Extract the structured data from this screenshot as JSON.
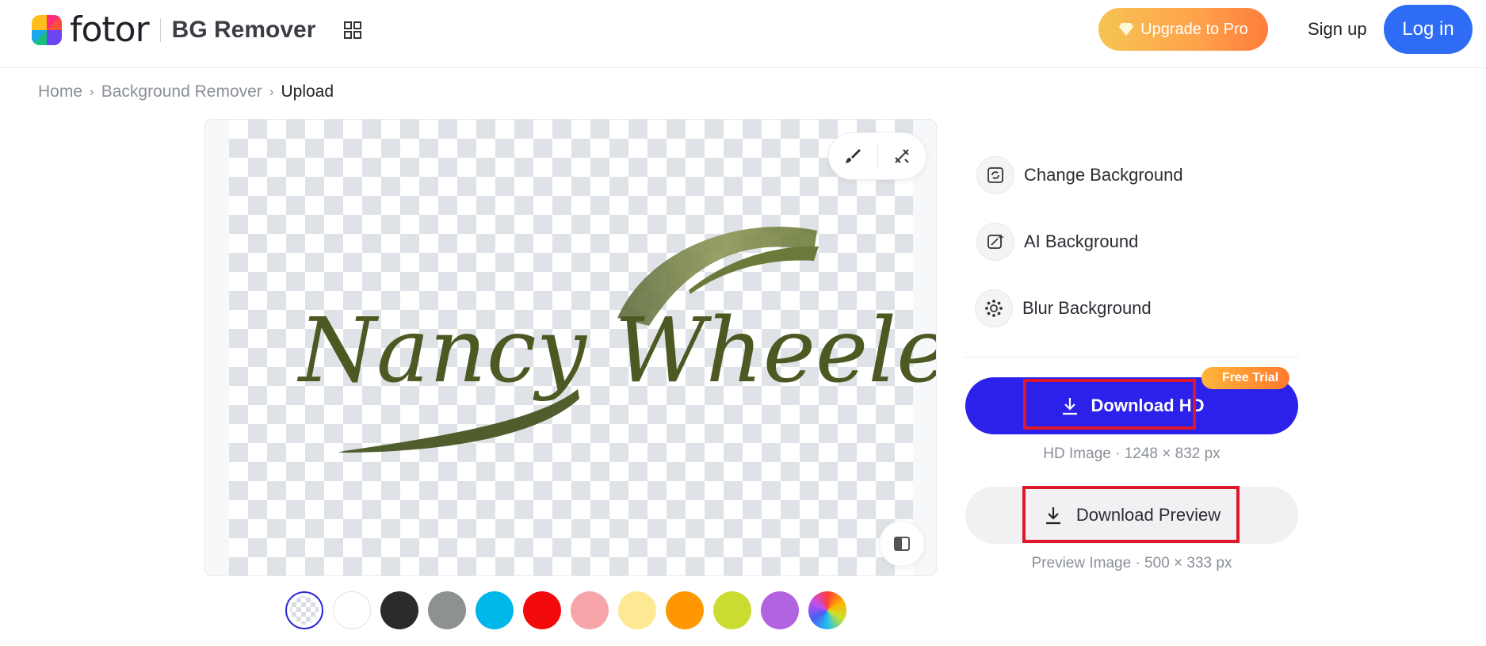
{
  "header": {
    "brand": "fotor",
    "product": "BG Remover",
    "upgrade_label": "Upgrade to Pro",
    "signup_label": "Sign up",
    "login_label": "Log in"
  },
  "breadcrumb": {
    "items": [
      "Home",
      "Background Remover"
    ],
    "current": "Upload"
  },
  "canvas": {
    "signature_text": "Nancy Wheeler"
  },
  "swatches": [
    {
      "name": "transparent",
      "color": "transparent"
    },
    {
      "name": "white",
      "color": "#ffffff"
    },
    {
      "name": "black",
      "color": "#2b2b2b"
    },
    {
      "name": "gray",
      "color": "#8e9191"
    },
    {
      "name": "cyan",
      "color": "#00b7ea"
    },
    {
      "name": "red",
      "color": "#f20a0a"
    },
    {
      "name": "pink",
      "color": "#f7a4a9"
    },
    {
      "name": "yellow",
      "color": "#fde893"
    },
    {
      "name": "orange",
      "color": "#ff9800"
    },
    {
      "name": "lime",
      "color": "#cadb31"
    },
    {
      "name": "purple",
      "color": "#b062e0"
    },
    {
      "name": "custom",
      "color": "rainbow"
    }
  ],
  "panel": {
    "options": [
      {
        "label": "Change Background",
        "icon": "change-background-icon"
      },
      {
        "label": "AI Background",
        "icon": "ai-background-icon"
      },
      {
        "label": "Blur Background",
        "icon": "blur-background-icon"
      }
    ],
    "download_hd_label": "Download HD",
    "free_trial_badge": "Free Trial",
    "hd_info": "HD Image · 1248 × 832 px",
    "download_preview_label": "Download Preview",
    "preview_info": "Preview Image · 500 × 333 px"
  },
  "colors": {
    "accent_blue": "#2b21ea",
    "login_blue": "#2e6cf5",
    "highlight_red": "#e0172a"
  }
}
